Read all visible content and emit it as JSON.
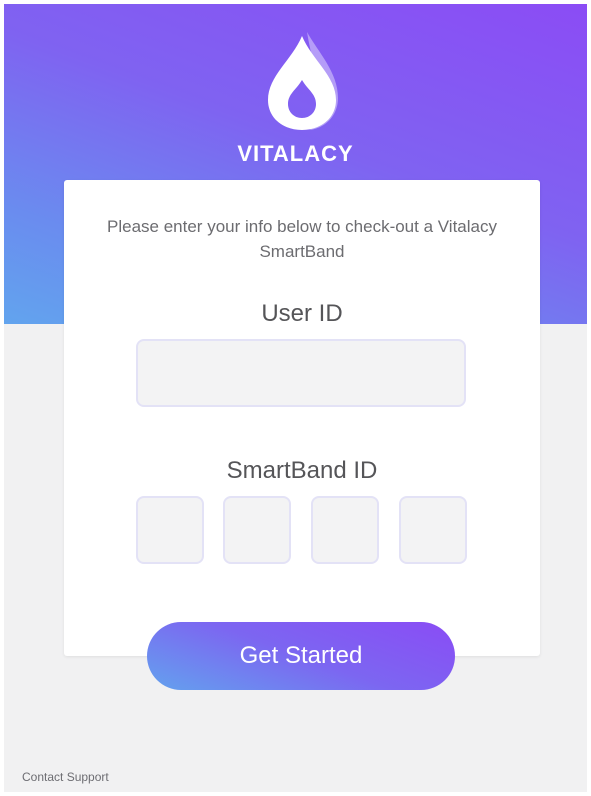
{
  "brand": {
    "logo_icon": "water-drop-icon",
    "name": "VITALACY",
    "gradient_start": "#8b4cf5",
    "gradient_end": "#62a4ee"
  },
  "form": {
    "intro": "Please enter your info below to check-out a Vitalacy SmartBand",
    "user_id_label": "User ID",
    "user_id_value": "",
    "smartband_id_label": "SmartBand ID",
    "smartband_digits": [
      "",
      "",
      "",
      ""
    ]
  },
  "actions": {
    "get_started_label": "Get Started",
    "contact_support_label": "Contact Support"
  }
}
